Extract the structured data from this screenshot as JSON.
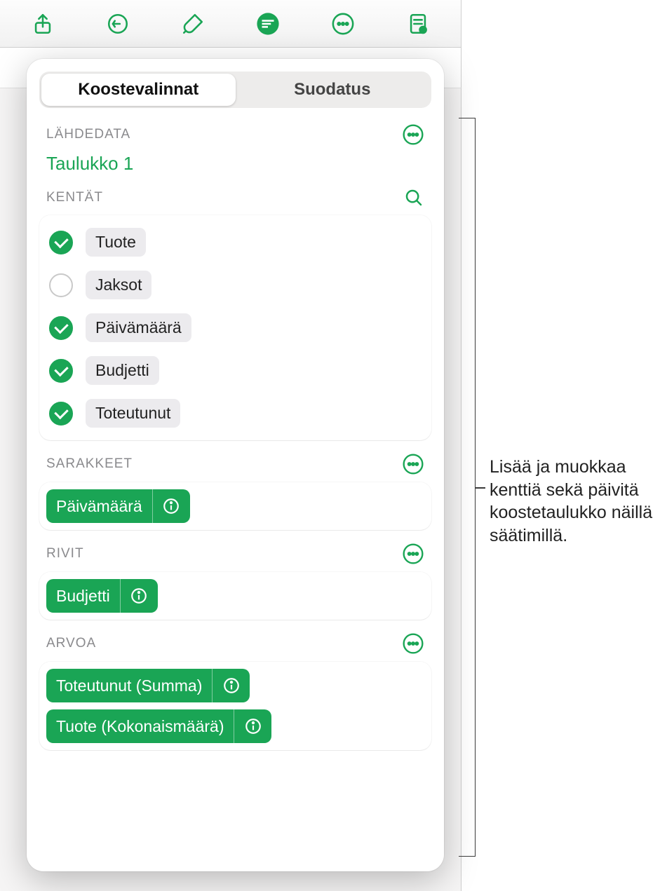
{
  "tabs": {
    "pivot": "Koostevalinnat",
    "filter": "Suodatus"
  },
  "sections": {
    "source": "LÄHDEDATA",
    "fields": "KENTÄT",
    "columns": "SARAKKEET",
    "rows": "RIVIT",
    "values": "ARVOA"
  },
  "source_table": "Taulukko 1",
  "fields": [
    {
      "label": "Tuote",
      "checked": true
    },
    {
      "label": "Jaksot",
      "checked": false
    },
    {
      "label": "Päivämäärä",
      "checked": true
    },
    {
      "label": "Budjetti",
      "checked": true
    },
    {
      "label": "Toteutunut",
      "checked": true
    }
  ],
  "columns": [
    {
      "label": "Päivämäärä"
    }
  ],
  "rows": [
    {
      "label": "Budjetti"
    }
  ],
  "values": [
    {
      "label": "Toteutunut (Summa)"
    },
    {
      "label": "Tuote (Kokonaismäärä)"
    }
  ],
  "callout": "Lisää ja muokkaa kenttiä sekä päivitä koostetaulukko näillä säätimillä."
}
